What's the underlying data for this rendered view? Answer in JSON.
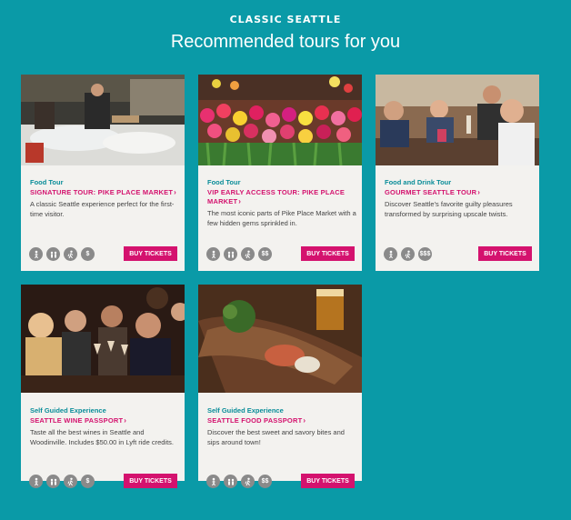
{
  "header": {
    "eyebrow": "CLASSIC SEATTLE",
    "title": "Recommended tours for you"
  },
  "cards": [
    {
      "category": "Food Tour",
      "title": "SIGNATURE TOUR: PIKE PLACE MARKET",
      "description": "A classic Seattle experience perfect for the first-time visitor.",
      "icons": [
        "walking-icon",
        "group-icon",
        "hiker-icon",
        "dollar-icon"
      ],
      "price": "$",
      "button": "BUY TICKETS"
    },
    {
      "category": "Food Tour",
      "title": "VIP EARLY ACCESS TOUR: PIKE PLACE MARKET",
      "description": "The most iconic parts of Pike Place Market with a few hidden gems sprinkled in.",
      "icons": [
        "walking-icon",
        "group-icon",
        "hiker-icon",
        "dollar-icon"
      ],
      "price": "$$",
      "button": "BUY TICKETS"
    },
    {
      "category": "Food and Drink Tour",
      "title": "GOURMET SEATTLE TOUR",
      "description": "Discover Seattle's favorite guilty pleasures transformed by surprising upscale twists.",
      "icons": [
        "walking-icon",
        "hiker-icon",
        "dollar-icon"
      ],
      "price": "$$$",
      "button": "BUY TICKETS"
    },
    {
      "category": "Self Guided Experience",
      "title": "SEATTLE WINE PASSPORT",
      "description": "Taste all the best wines in Seattle and Woodinville. Includes $50.00 in Lyft ride credits.",
      "icons": [
        "walking-icon",
        "group-icon",
        "hiker-icon",
        "dollar-icon"
      ],
      "price": "$",
      "button": "BUY TICKETS"
    },
    {
      "category": "Self Guided Experience",
      "title": "SEATTLE FOOD PASSPORT",
      "description": "Discover the best sweet and savory bites and sips around town!",
      "icons": [
        "walking-icon",
        "group-icon",
        "hiker-icon",
        "dollar-icon"
      ],
      "price": "$$",
      "button": "BUY TICKETS"
    }
  ],
  "colors": {
    "background": "#0a9aa7",
    "accent": "#d4126e",
    "category": "#0a8d99",
    "card": "#f3f2ef",
    "icon": "#8a8a8a"
  }
}
